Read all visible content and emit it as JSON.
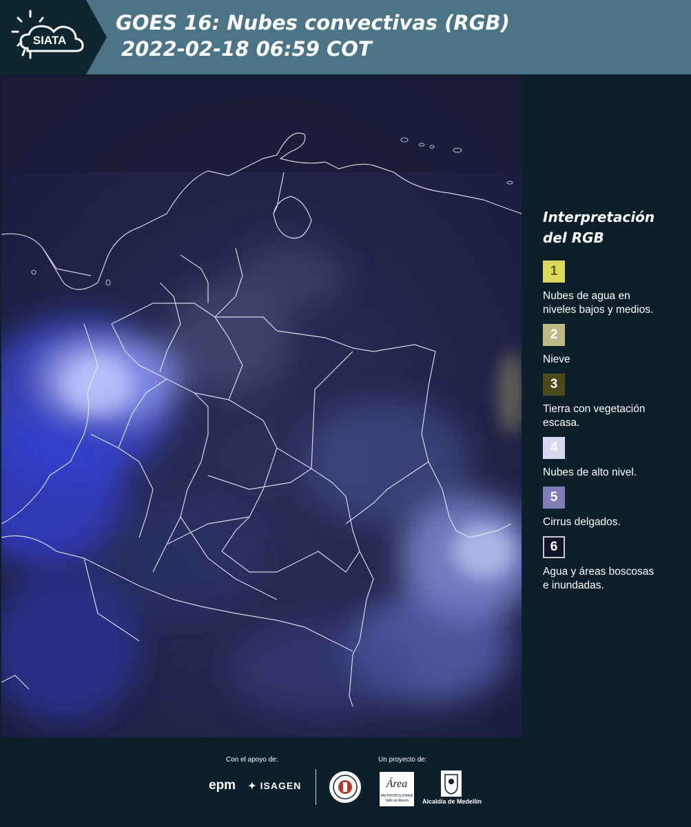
{
  "header": {
    "logo_text": "SIATA",
    "title_line1": "GOES 16: Nubes convectivas (RGB)",
    "title_line2": "2022-02-18 06:59 COT"
  },
  "map": {
    "description_icon": "satellite-rgb-map"
  },
  "legend": {
    "title_line1": "Interpretación",
    "title_line2": "del RGB",
    "items": [
      {
        "num": "1",
        "color": "#dcd95c",
        "text_color": "#5d5a24",
        "label_line1": "Nubes de agua en",
        "label_line2": "niveles bajos y medios."
      },
      {
        "num": "2",
        "color": "#bcba86",
        "text_color": "#ffffff",
        "label_line1": "Nieve",
        "label_line2": ""
      },
      {
        "num": "3",
        "color": "#4c4a1d",
        "text_color": "#ffffff",
        "label_line1": "Tierra con vegetación",
        "label_line2": "escasa."
      },
      {
        "num": "4",
        "color": "#d8d8f3",
        "text_color": "#ffffff",
        "label_line1": "Nubes de alto nivel.",
        "label_line2": ""
      },
      {
        "num": "5",
        "color": "#7d7db7",
        "text_color": "#ffffff",
        "label_line1": "Cirrus delgados.",
        "label_line2": ""
      },
      {
        "num": "6",
        "color": "#101427",
        "text_color": "#ffffff",
        "label_line1": "Agua y áreas boscosas",
        "label_line2": "e inundadas."
      }
    ]
  },
  "footer": {
    "support_label": "Con el apoyo de:",
    "project_label": "Un proyecto de:",
    "epm": "epm",
    "isagen": "ISAGEN",
    "amva_text": "Área",
    "amva_sub1": "METROPOLITANA",
    "amva_sub2": "Valle de Aburrá",
    "alcaldia": "Alcaldía de Medellín"
  }
}
